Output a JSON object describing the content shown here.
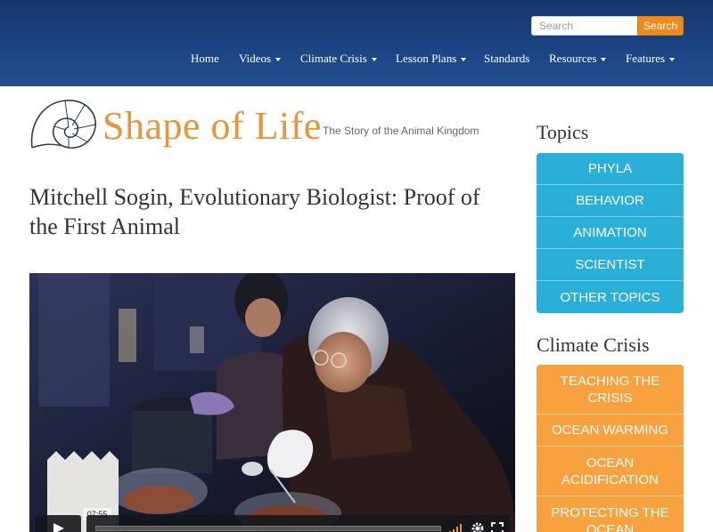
{
  "search": {
    "placeholder": "Search",
    "button_label": "Search"
  },
  "nav": {
    "items": [
      {
        "label": "Home",
        "has_caret": false
      },
      {
        "label": "Videos",
        "has_caret": true
      },
      {
        "label": "Climate Crisis",
        "has_caret": true
      },
      {
        "label": "Lesson Plans",
        "has_caret": true
      },
      {
        "label": "Standards",
        "has_caret": false
      },
      {
        "label": "Resources",
        "has_caret": true
      },
      {
        "label": "Features",
        "has_caret": true
      }
    ]
  },
  "logo": {
    "name": "Shape of Life",
    "tagline": "The Story of the Animal Kingdom"
  },
  "page": {
    "title": "Mitchell Sogin, Evolutionary Biologist: Proof of the First Animal"
  },
  "video": {
    "time": "07:55",
    "progress": 0
  },
  "sidebar": {
    "topics_heading": "Topics",
    "topics": [
      "PHYLA",
      "BEHAVIOR",
      "ANIMATION",
      "SCIENTIST",
      "OTHER TOPICS"
    ],
    "climate_heading": "Climate Crisis",
    "climate": [
      "TEACHING THE CRISIS",
      "OCEAN WARMING",
      "OCEAN ACIDIFICATION",
      "PROTECTING THE OCEAN"
    ]
  },
  "colors": {
    "header_bg": "#1c4585",
    "search_button": "#ee8a1d",
    "logo_orange": "#e8943a",
    "topics_blue": "#2ab0d8",
    "climate_orange": "#f7a23f"
  },
  "icons": {
    "logo": "nautilus-shell-icon",
    "play": "play-icon",
    "volume": "volume-icon",
    "settings": "gear-icon",
    "fullscreen": "fullscreen-icon"
  }
}
